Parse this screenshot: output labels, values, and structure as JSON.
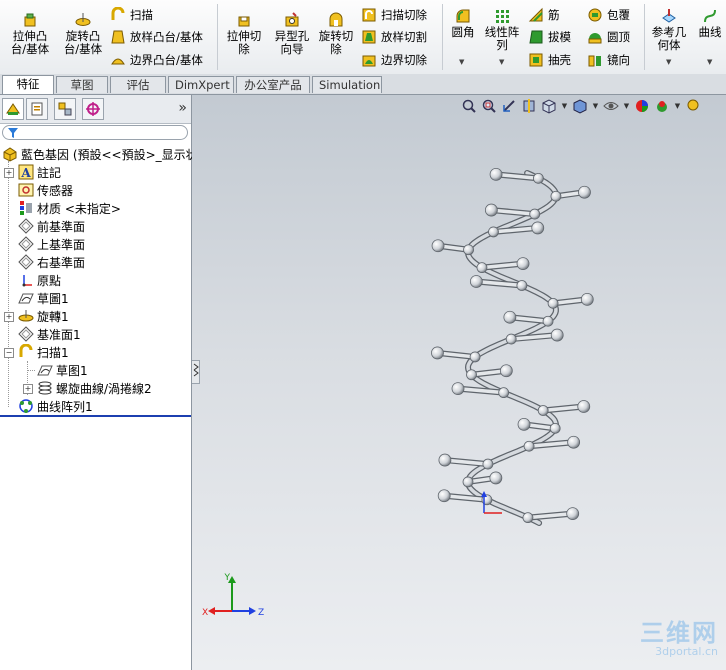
{
  "ribbon": {
    "extrude_boss": "拉伸凸\n台/基体",
    "revolve_boss": "旋转凸\n台/基体",
    "sweep": "扫描",
    "loft": "放样凸台/基体",
    "boundary_boss": "边界凸台/基体",
    "extrude_cut": "拉伸切\n除",
    "hole_wizard": "异型孔\n向导",
    "revolve_cut": "旋转切\n除",
    "swept_cut": "扫描切除",
    "lofted_cut": "放样切割",
    "boundary_cut": "边界切除",
    "fillet": "圆角",
    "linear_pattern": "线性阵\n列",
    "rib": "筋",
    "draft": "拔模",
    "shell": "抽壳",
    "wrap": "包覆",
    "dome": "圆顶",
    "mirror": "镜向",
    "ref_geometry": "参考几\n何体",
    "curves": "曲线"
  },
  "tabs": [
    {
      "label": "特征",
      "active": true
    },
    {
      "label": "草图"
    },
    {
      "label": "评估"
    },
    {
      "label": "DimXpert"
    },
    {
      "label": "办公室产品"
    },
    {
      "label": "Simulation"
    }
  ],
  "panel": {
    "collapse_glyph": "»",
    "tree": [
      {
        "label": "藍色基因  (預設<<預設>_显示状",
        "icon": "part-icon"
      },
      {
        "label": "註記",
        "icon": "annotation-icon"
      },
      {
        "label": "传感器",
        "icon": "sensor-icon"
      },
      {
        "label": "材质 <未指定>",
        "icon": "material-icon"
      },
      {
        "label": "前基準面",
        "icon": "plane-icon"
      },
      {
        "label": "上基準面",
        "icon": "plane-icon"
      },
      {
        "label": "右基準面",
        "icon": "plane-icon"
      },
      {
        "label": "原點",
        "icon": "origin-icon"
      },
      {
        "label": "草圖1",
        "icon": "sketch-icon"
      },
      {
        "label": "旋轉1",
        "icon": "revolve-icon"
      },
      {
        "label": "基准面1",
        "icon": "plane-icon"
      },
      {
        "label": "扫描1",
        "icon": "sweep-icon"
      },
      {
        "label": "草图1",
        "icon": "sketch-icon"
      },
      {
        "label": "螺旋曲線/渦捲線2",
        "icon": "helix-icon"
      },
      {
        "label": "曲线阵列1",
        "icon": "curve-pattern-icon"
      }
    ]
  },
  "triad": {
    "x": "X",
    "y": "Y",
    "z": "Z"
  },
  "watermark": {
    "title": "三维网",
    "url": "3dportal.cn"
  },
  "colors": {
    "ribbon_icon_yellow": "#f0c020",
    "ribbon_icon_green": "#2f9a2f",
    "triad_x": "#e02020",
    "triad_y": "#1c9a1c",
    "triad_z": "#2040e0"
  }
}
